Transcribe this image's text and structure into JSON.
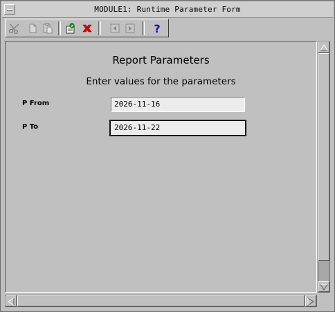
{
  "window": {
    "title": "MODULE1: Runtime Parameter Form"
  },
  "toolbar": {
    "buttons": [
      {
        "icon": "scissors-icon",
        "enabled": false
      },
      {
        "icon": "copy-icon",
        "enabled": false
      },
      {
        "icon": "paste-icon",
        "enabled": false
      },
      {
        "icon": "run-report-icon",
        "enabled": true
      },
      {
        "icon": "cancel-icon",
        "enabled": true
      },
      {
        "icon": "previous-page-icon",
        "enabled": false
      },
      {
        "icon": "next-page-icon",
        "enabled": false
      },
      {
        "icon": "help-icon",
        "enabled": true
      }
    ]
  },
  "form": {
    "heading": "Report Parameters",
    "subheading": "Enter values for the parameters",
    "params": [
      {
        "label": "P From",
        "value": "2026-11-16"
      },
      {
        "label": "P To",
        "value": "2026-11-22"
      }
    ]
  },
  "colors": {
    "background": "#c0c0c0",
    "field": "#ececec",
    "cancel_red": "#e00000",
    "help_blue": "#1010c0",
    "run_green": "#10a010"
  }
}
